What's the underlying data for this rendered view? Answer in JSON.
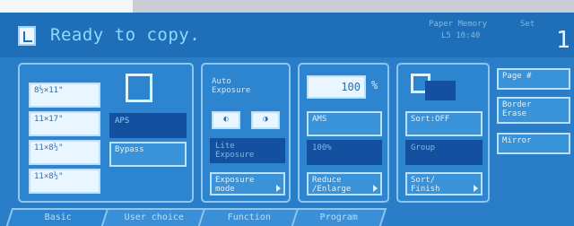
{
  "header": {
    "title": "Ready to copy.",
    "status_1": "Paper  Memory",
    "status_2": "Set",
    "status_3": "L5  10:40",
    "copy_count": "1"
  },
  "paper": {
    "sizes": [
      "8½×11\"",
      "11×17\"",
      "11×8½\"",
      "11×8½\""
    ],
    "auto_label": "APS",
    "bypass_label": "Bypass"
  },
  "exposure": {
    "auto_label": "Auto\nExposure",
    "dark_button": "Lite\nExposure",
    "mode_button": "Exposure\nmode"
  },
  "ratio": {
    "value": "100",
    "unit": "%",
    "auto_label": "AMS",
    "dark_button": "100%",
    "reduce_button": "Reduce\n/Enlarge"
  },
  "sort": {
    "sort_button": "Sort:OFF",
    "dark_button": "Group",
    "finish_button": "Sort/\nFinish"
  },
  "side_options": [
    "Page #",
    "Border\nErase",
    "Mirror"
  ],
  "tabs": [
    "Basic",
    "User choice",
    "Function",
    "Program"
  ]
}
